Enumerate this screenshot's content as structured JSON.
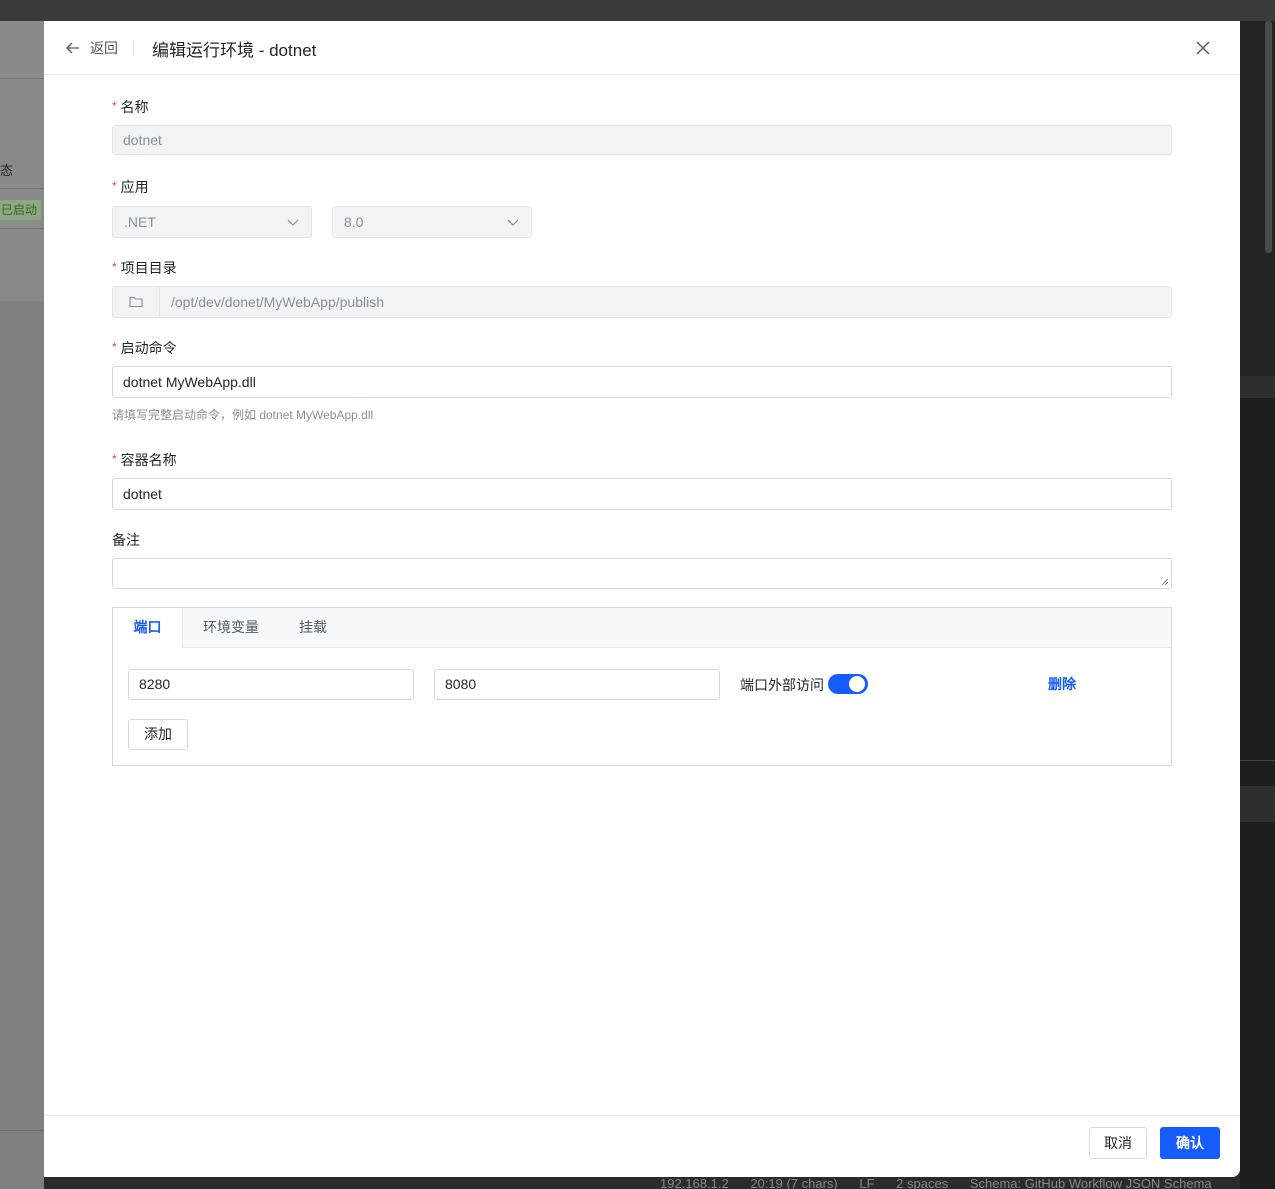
{
  "background": {
    "status_header": "态",
    "status_badge": "已启动",
    "statusbar": [
      "192.168.1.2",
      "20:19 (7 chars)",
      "LF",
      "2 spaces",
      "Schema: GitHub Workflow JSON Schema"
    ]
  },
  "drawer": {
    "back_label": "返回",
    "title": "编辑运行环境 - dotnet"
  },
  "form": {
    "required_mark": "*",
    "name": {
      "label": "名称",
      "value": "dotnet"
    },
    "app": {
      "label": "应用",
      "type_value": ".NET",
      "version_value": "8.0"
    },
    "project_dir": {
      "label": "项目目录",
      "value": "/opt/dev/donet/MyWebApp/publish"
    },
    "start_cmd": {
      "label": "启动命令",
      "value": "dotnet MyWebApp.dll",
      "help": "请填写完整启动命令，例如 dotnet MyWebApp.dll"
    },
    "container_name": {
      "label": "容器名称",
      "value": "dotnet"
    },
    "remark": {
      "label": "备注",
      "value": ""
    }
  },
  "tabs": {
    "items": [
      {
        "label": "端口",
        "active": true
      },
      {
        "label": "环境变量",
        "active": false
      },
      {
        "label": "挂载",
        "active": false
      }
    ],
    "ports": {
      "host_port": "8280",
      "container_port": "8080",
      "external_label": "端口外部访问",
      "external_enabled": true,
      "delete_label": "删除",
      "add_label": "添加"
    }
  },
  "footer": {
    "cancel_label": "取消",
    "confirm_label": "确认"
  },
  "colors": {
    "primary": "#165dff",
    "required": "#f53f3f",
    "disabled_bg": "#f2f3f5"
  }
}
